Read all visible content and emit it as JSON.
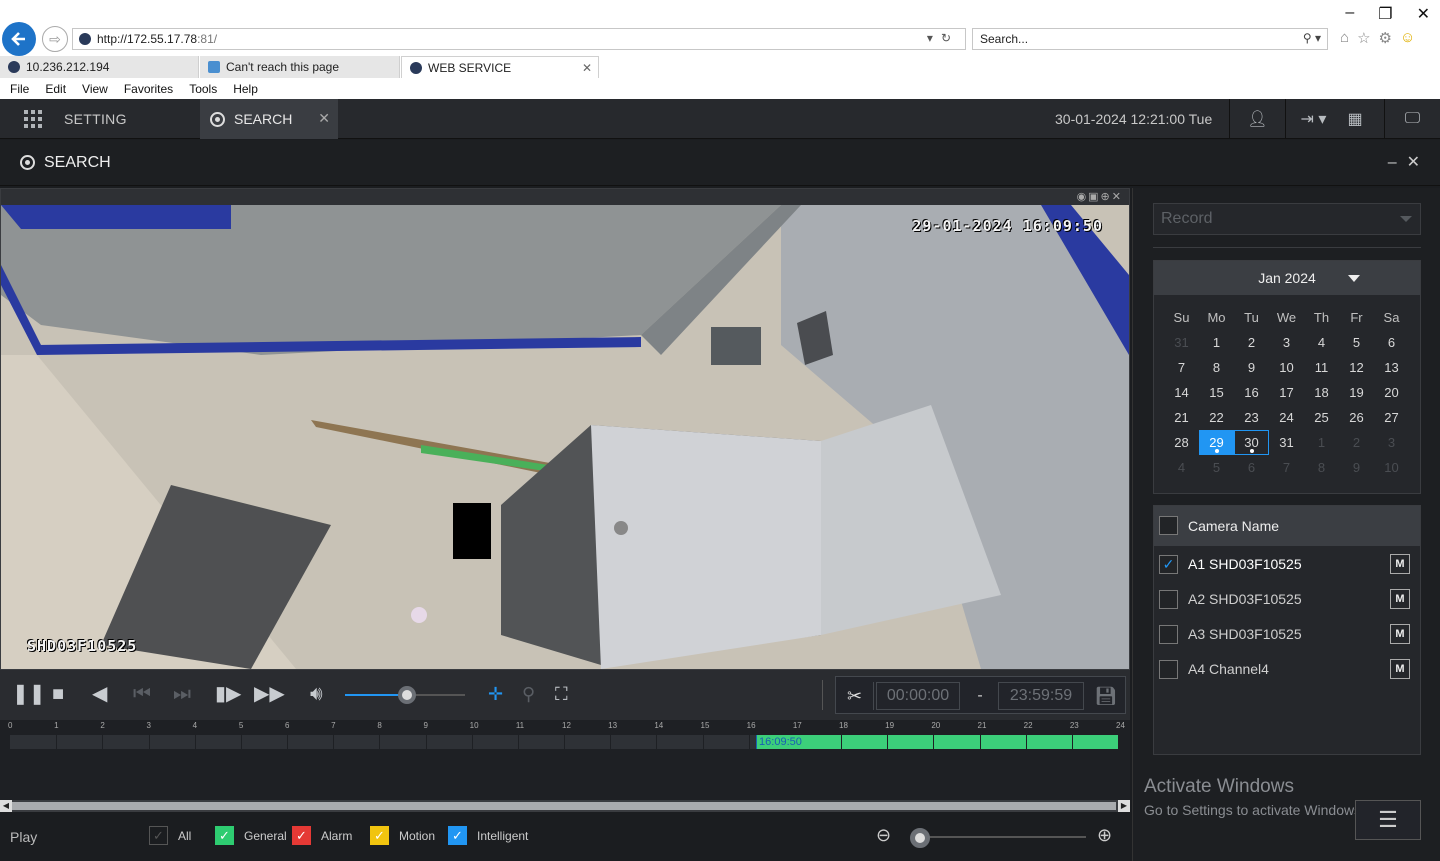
{
  "browser": {
    "url_host": "http://172.55.17.78",
    "url_port": ":81/",
    "search_placeholder": "Search...",
    "tabs": [
      {
        "label": "10.236.212.194"
      },
      {
        "label": "Can't reach this page"
      },
      {
        "label": "WEB SERVICE"
      }
    ],
    "menu": [
      "File",
      "Edit",
      "View",
      "Favorites",
      "Tools",
      "Help"
    ]
  },
  "header": {
    "setting_label": "SETTING",
    "search_tab_label": "SEARCH",
    "datetime": "30-01-2024 12:21:00 Tue"
  },
  "panel": {
    "title": "SEARCH"
  },
  "video": {
    "osd_time": "29-01-2024 16:09:50",
    "osd_camera": "SHD03F10525"
  },
  "controls": {
    "volume_level": 0.5,
    "clip_start": "00:00:00",
    "clip_dash": "-",
    "clip_end": "23:59:59"
  },
  "timeline": {
    "hours": [
      "0",
      "1",
      "2",
      "3",
      "4",
      "5",
      "6",
      "7",
      "8",
      "9",
      "10",
      "11",
      "12",
      "13",
      "14",
      "15",
      "16",
      "17",
      "18",
      "19",
      "20",
      "21",
      "22",
      "23",
      "24"
    ],
    "cursor_time": "16:09:50",
    "record_start_hour": 16.16,
    "record_end_hour": 24
  },
  "bottom": {
    "play_label": "Play",
    "filters": [
      {
        "label": "All",
        "color": "#3a3c40",
        "checked": true
      },
      {
        "label": "General",
        "color": "#2ecc71",
        "checked": true
      },
      {
        "label": "Alarm",
        "color": "#e53935",
        "checked": true
      },
      {
        "label": "Motion",
        "color": "#f1c40f",
        "checked": true
      },
      {
        "label": "Intelligent",
        "color": "#2196f3",
        "checked": true
      }
    ],
    "zoom_level": 0
  },
  "right": {
    "record_type": "Record",
    "calendar": {
      "month_label": "Jan 2024",
      "dow": [
        "Su",
        "Mo",
        "Tu",
        "We",
        "Th",
        "Fr",
        "Sa"
      ],
      "weeks": [
        [
          "31",
          "1",
          "2",
          "3",
          "4",
          "5",
          "6"
        ],
        [
          "7",
          "8",
          "9",
          "10",
          "11",
          "12",
          "13"
        ],
        [
          "14",
          "15",
          "16",
          "17",
          "18",
          "19",
          "20"
        ],
        [
          "21",
          "22",
          "23",
          "24",
          "25",
          "26",
          "27"
        ],
        [
          "28",
          "29",
          "30",
          "31",
          "1",
          "2",
          "3"
        ],
        [
          "4",
          "5",
          "6",
          "7",
          "8",
          "9",
          "10"
        ]
      ],
      "selected": "29",
      "today": "30"
    },
    "camera_header": "Camera Name",
    "cameras": [
      {
        "name": "A1 SHD03F10525",
        "checked": true,
        "m": "M"
      },
      {
        "name": "A2 SHD03F10525",
        "checked": false,
        "m": "M"
      },
      {
        "name": "A3 SHD03F10525",
        "checked": false,
        "m": "M"
      },
      {
        "name": "A4 Channel4",
        "checked": false,
        "m": "M"
      }
    ],
    "activate_title": "Activate Windows",
    "activate_sub": "Go to Settings to activate Windows."
  },
  "colors": {
    "accent": "#2196f3",
    "record_green": "#3ccf7a"
  }
}
